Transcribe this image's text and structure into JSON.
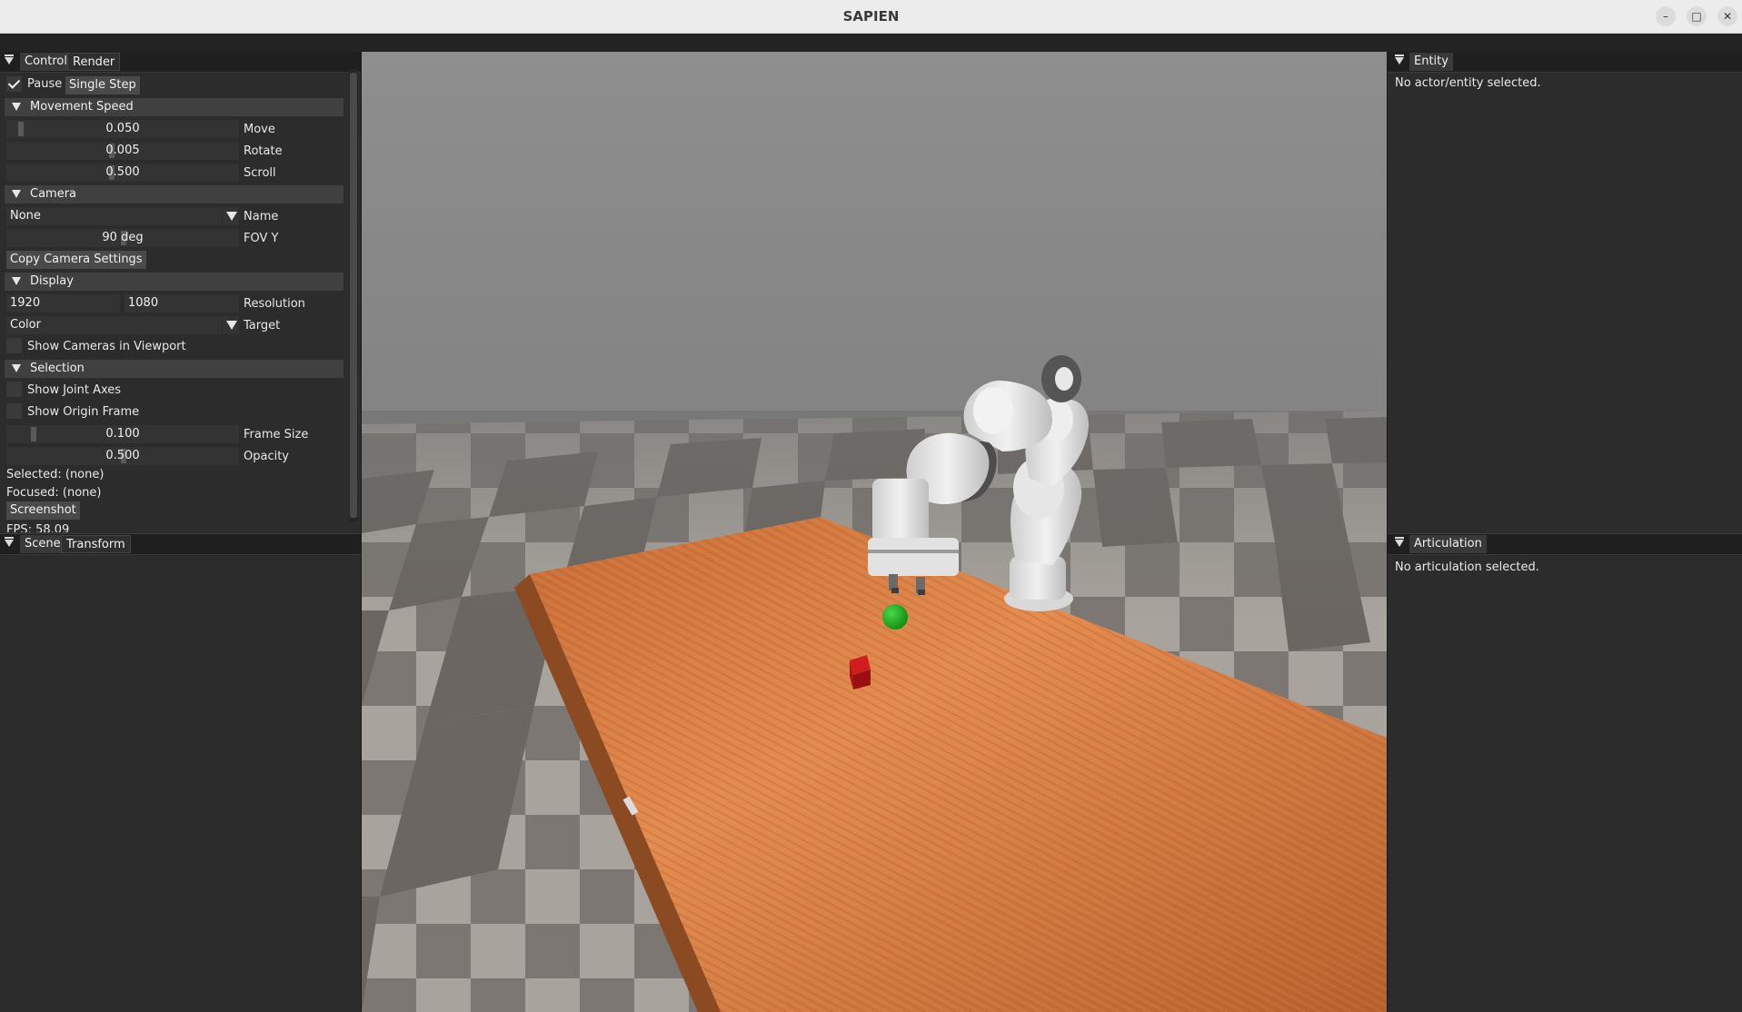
{
  "window": {
    "title": "SAPIEN"
  },
  "control_panel": {
    "tabs": [
      {
        "label": "Control"
      },
      {
        "label": "Render"
      }
    ],
    "pause_label": "Pause",
    "pause_checked": true,
    "single_step_label": "Single Step",
    "movement_speed": {
      "title": "Movement Speed",
      "move": {
        "value": "0.050",
        "label": "Move"
      },
      "rotate": {
        "value": "0.005",
        "label": "Rotate"
      },
      "scroll": {
        "value": "0.500",
        "label": "Scroll"
      }
    },
    "camera": {
      "title": "Camera",
      "name_value": "None",
      "name_label": "Name",
      "fov_value": "90 deg",
      "fov_label": "FOV Y",
      "copy_button": "Copy Camera Settings"
    },
    "display": {
      "title": "Display",
      "res_width": "1920",
      "res_height": "1080",
      "resolution_label": "Resolution",
      "target_value": "Color",
      "target_label": "Target",
      "show_cameras_label": "Show Cameras in Viewport"
    },
    "selection": {
      "title": "Selection",
      "show_joint_axes_label": "Show Joint Axes",
      "show_origin_frame_label": "Show Origin Frame",
      "frame_size": {
        "value": "0.100",
        "label": "Frame Size"
      },
      "opacity": {
        "value": "0.500",
        "label": "Opacity"
      },
      "selected_text": "Selected: (none)",
      "focused_text": "Focused: (none)",
      "screenshot_button": "Screenshot",
      "fps_text": "FPS: 58.09"
    }
  },
  "scene_panel": {
    "tabs": [
      {
        "label": "Scene"
      },
      {
        "label": "Transform"
      }
    ]
  },
  "entity_panel": {
    "tab": "Entity",
    "message": "No actor/entity selected."
  },
  "articulation_panel": {
    "tab": "Articulation",
    "message": "No articulation selected."
  }
}
